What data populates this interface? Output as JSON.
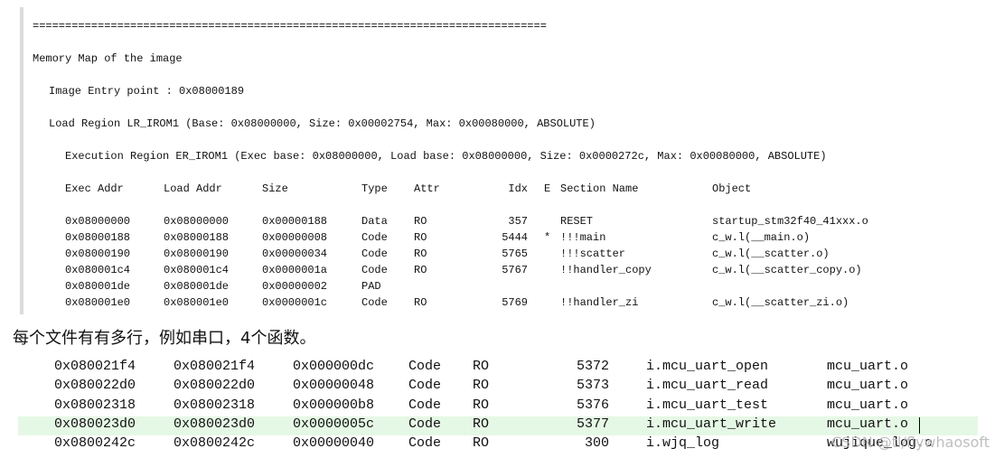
{
  "memory_map": {
    "separator": "===============================================================================",
    "title": "Memory Map of the image",
    "entry_point": "Image Entry point : 0x08000189",
    "load_region": "Load Region LR_IROM1 (Base: 0x08000000, Size: 0x00002754, Max: 0x00080000, ABSOLUTE)",
    "exec_region": "Execution Region ER_IROM1 (Exec base: 0x08000000, Load base: 0x08000000, Size: 0x0000272c, Max: 0x00080000, ABSOLUTE)",
    "headers": {
      "exec_addr": "Exec Addr",
      "load_addr": "Load Addr",
      "size": "Size",
      "type": "Type",
      "attr": "Attr",
      "idx": "Idx",
      "e": "E",
      "section": "Section Name",
      "object": "Object"
    },
    "rows": [
      {
        "exec": "0x08000000",
        "load": "0x08000000",
        "size": "0x00000188",
        "type": "Data",
        "attr": "RO",
        "idx": "357",
        "e": "",
        "section": "RESET",
        "object": "startup_stm32f40_41xxx.o"
      },
      {
        "exec": "0x08000188",
        "load": "0x08000188",
        "size": "0x00000008",
        "type": "Code",
        "attr": "RO",
        "idx": "5444",
        "e": "*",
        "section": "!!!main",
        "object": "c_w.l(__main.o)"
      },
      {
        "exec": "0x08000190",
        "load": "0x08000190",
        "size": "0x00000034",
        "type": "Code",
        "attr": "RO",
        "idx": "5765",
        "e": "",
        "section": "!!!scatter",
        "object": "c_w.l(__scatter.o)"
      },
      {
        "exec": "0x080001c4",
        "load": "0x080001c4",
        "size": "0x0000001a",
        "type": "Code",
        "attr": "RO",
        "idx": "5767",
        "e": "",
        "section": "!!handler_copy",
        "object": "c_w.l(__scatter_copy.o)"
      },
      {
        "exec": "0x080001de",
        "load": "0x080001de",
        "size": "0x00000002",
        "type": "PAD",
        "attr": "",
        "idx": "",
        "e": "",
        "section": "",
        "object": ""
      },
      {
        "exec": "0x080001e0",
        "load": "0x080001e0",
        "size": "0x0000001c",
        "type": "Code",
        "attr": "RO",
        "idx": "5769",
        "e": "",
        "section": "!!handler_zi",
        "object": "c_w.l(__scatter_zi.o)"
      }
    ]
  },
  "caption": "每个文件有有多行，例如串口，4个函数。",
  "uart_map": {
    "partial_line": "_  _  ",
    "rows": [
      {
        "exec": "0x080021f4",
        "load": "0x080021f4",
        "size": "0x000000dc",
        "type": "Code",
        "attr": "RO",
        "idx": "5372",
        "section": "i.mcu_uart_open",
        "object": "mcu_uart.o",
        "highlight": false
      },
      {
        "exec": "0x080022d0",
        "load": "0x080022d0",
        "size": "0x00000048",
        "type": "Code",
        "attr": "RO",
        "idx": "5373",
        "section": "i.mcu_uart_read",
        "object": "mcu_uart.o",
        "highlight": false
      },
      {
        "exec": "0x08002318",
        "load": "0x08002318",
        "size": "0x000000b8",
        "type": "Code",
        "attr": "RO",
        "idx": "5376",
        "section": "i.mcu_uart_test",
        "object": "mcu_uart.o",
        "highlight": false
      },
      {
        "exec": "0x080023d0",
        "load": "0x080023d0",
        "size": "0x0000005c",
        "type": "Code",
        "attr": "RO",
        "idx": "5377",
        "section": "i.mcu_uart_write",
        "object": "mcu_uart.o",
        "highlight": true
      },
      {
        "exec": "0x0800242c",
        "load": "0x0800242c",
        "size": "0x00000040",
        "type": "Code",
        "attr": "RO",
        "idx": "300",
        "section": "i.wjq_log",
        "object": "wujique_log.o",
        "highlight": false
      }
    ]
  },
  "watermark": "CSDN @tl/flywhaosoft",
  "colors": {
    "highlight_row": "#e5f8e5",
    "left_border": "#dcdcdc"
  }
}
